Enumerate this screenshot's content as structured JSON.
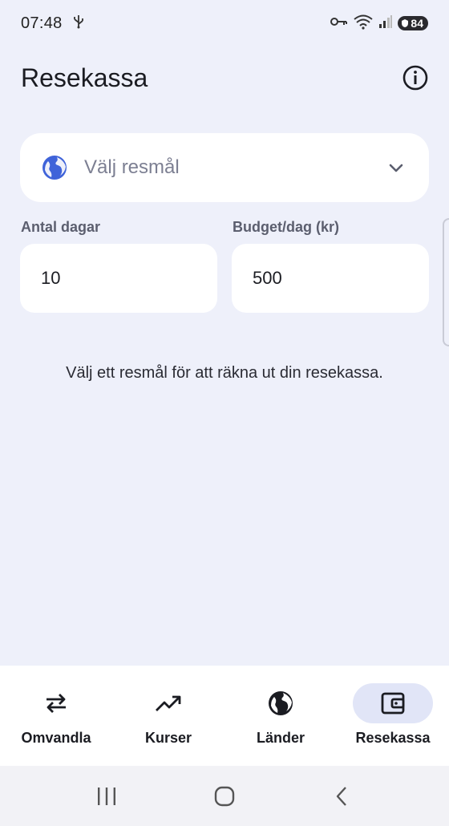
{
  "status_bar": {
    "time": "07:48",
    "battery_level": "84",
    "icons": [
      "usb-icon",
      "vpn-key-icon",
      "wifi-icon",
      "signal-icon",
      "battery-icon"
    ]
  },
  "app_bar": {
    "title": "Resekassa",
    "info_icon": "info-icon"
  },
  "destination": {
    "placeholder": "Välj resmål",
    "icon": "globe-icon",
    "dropdown_icon": "chevron-down-icon"
  },
  "fields": {
    "days": {
      "label": "Antal dagar",
      "value": "10"
    },
    "budget": {
      "label": "Budget/dag (kr)",
      "value": "500"
    }
  },
  "hint": "Välj ett resmål för att räkna ut din resekassa.",
  "bottom_nav": {
    "items": [
      {
        "label": "Omvandla",
        "icon": "swap-arrows-icon",
        "active": false
      },
      {
        "label": "Kurser",
        "icon": "trending-up-icon",
        "active": false
      },
      {
        "label": "Länder",
        "icon": "globe-icon",
        "active": false
      },
      {
        "label": "Resekassa",
        "icon": "wallet-icon",
        "active": true
      }
    ]
  },
  "colors": {
    "background": "#EEF0FA",
    "surface": "#FFFFFF",
    "accent": "#3F63D9",
    "active_indicator": "#E1E5F7",
    "muted_text": "#7C7F92"
  }
}
